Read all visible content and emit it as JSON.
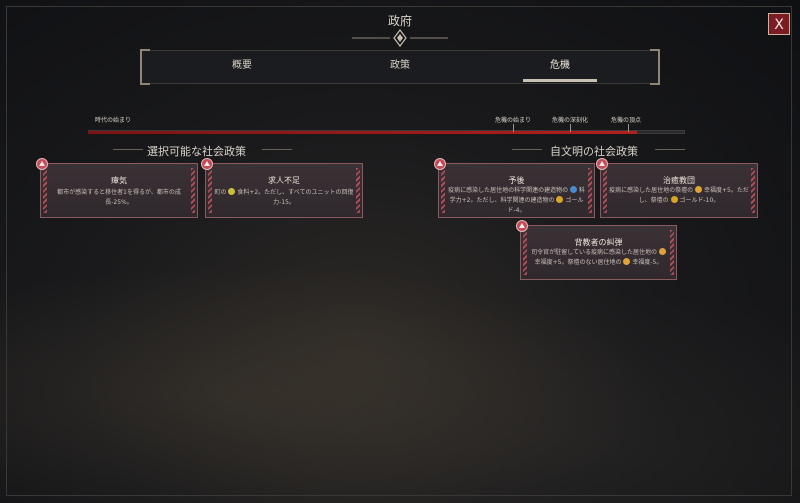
{
  "window": {
    "title": "政府",
    "close_label": "X"
  },
  "tabs": [
    {
      "label": "概要"
    },
    {
      "label": "政策"
    },
    {
      "label": "危機",
      "active": true
    }
  ],
  "timeline": {
    "start_label": "時代の始まり",
    "crisis_start_label": "危機の始まり",
    "crisis_deepen_label": "危機の深刻化",
    "crisis_peak_label": "危機の頂点",
    "progress": 0.92
  },
  "sections": {
    "available": "選択可能な社会政策",
    "self_evident": "自文明の社会政策"
  },
  "cards": {
    "miasma": {
      "title": "瘴気",
      "desc": "都市が感染すると移住者1を得るが、都市の成長-25%。"
    },
    "lack": {
      "title": "求人不足",
      "d1": "町の",
      "d2": "食料+2。ただし、すべてのユニットの回復力-15。"
    },
    "prevention": {
      "title": "予後",
      "d1": "疫病に感染した居住地の科学関連の建造物の",
      "d2": "科学力+2。ただし、科学関連の建造物の",
      "d3": "ゴールド-4。"
    },
    "healers": {
      "title": "治癒教団",
      "d1": "疫病に感染した居住地の祭壇の",
      "d2": "幸福度+5。ただし、祭壇の",
      "d3": "ゴールド-10。"
    },
    "apostate": {
      "title": "背教者の糾弾",
      "d1": "司令官が駐留している疫病に感染した居住地の",
      "d2": "幸福度+5。祭壇のない居住地の",
      "d3": "幸福度-5。"
    }
  },
  "icons": {
    "food": "food-icon",
    "science": "science-icon",
    "gold": "gold-icon",
    "happiness": "happiness-icon"
  },
  "colors": {
    "accent_red": "#b3201c",
    "card_border": "#8a5a60",
    "close_bg": "#7a1c22"
  }
}
